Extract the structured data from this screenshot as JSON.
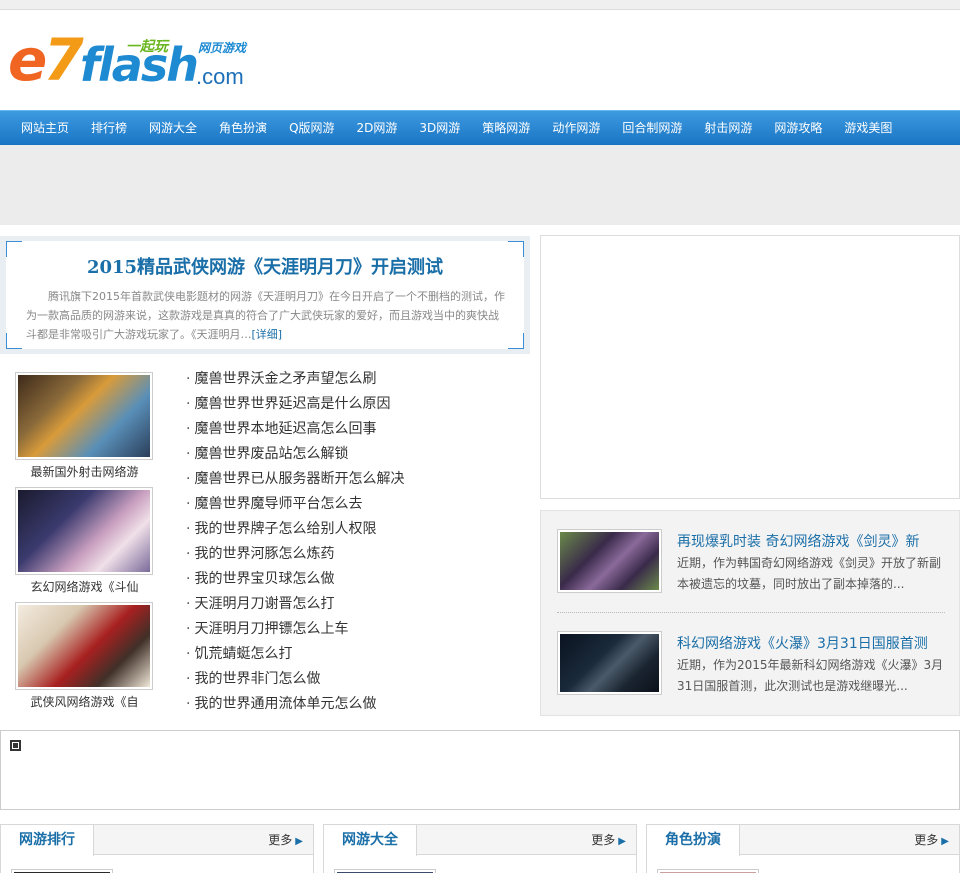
{
  "logo": {
    "brand_e7": "e7",
    "brand_flash": "flash",
    "brand_domain": ".com",
    "tagline_play": "一起玩",
    "tagline_webgame": "网页游戏"
  },
  "nav": {
    "items": [
      "网站主页",
      "排行榜",
      "网游大全",
      "角色扮演",
      "Q版网游",
      "2D网游",
      "3D网游",
      "策略网游",
      "动作网游",
      "回合制网游",
      "射击网游",
      "网游攻略",
      "游戏美图"
    ]
  },
  "headline": {
    "title": "2015精品武侠网游《天涯明月刀》开启测试",
    "summary": "腾讯旗下2015年首款武侠电影题材的网游《天涯明月刀》在今日开启了一个不删档的测试，作为一款高品质的网游来说，这款游戏是真真的符合了广大武侠玩家的爱好，而且游戏当中的爽快战斗都是非常吸引广大游戏玩家了。《天涯明月…",
    "more_label": "[详细]"
  },
  "thumbs": [
    {
      "caption": "最新国外射击网络游",
      "icon": "game-screenshot-shooter"
    },
    {
      "caption": "玄幻网络游戏《斗仙",
      "icon": "game-screenshot-fantasy"
    },
    {
      "caption": "武侠风网络游戏《自",
      "icon": "game-screenshot-wuxia"
    }
  ],
  "links": [
    "魔兽世界沃金之矛声望怎么刷",
    "魔兽世界世界延迟高是什么原因",
    "魔兽世界本地延迟高怎么回事",
    "魔兽世界废品站怎么解锁",
    "魔兽世界已从服务器断开怎么解决",
    "魔兽世界魔导师平台怎么去",
    "我的世界牌子怎么给别人权限",
    "我的世界河豚怎么炼药",
    "我的世界宝贝球怎么做",
    "天涯明月刀谢晋怎么打",
    "天涯明月刀押镖怎么上车",
    "饥荒蜻蜓怎么打",
    "我的世界非门怎么做",
    "我的世界通用流体单元怎么做"
  ],
  "news": [
    {
      "title": "再现爆乳时装 奇幻网络游戏《剑灵》新",
      "desc": "近期，作为韩国奇幻网络游戏《剑灵》开放了新副本被遗忘的坟墓，同时放出了副本掉落的..."
    },
    {
      "title": "科幻网络游戏《火瀑》3月31日国服首测",
      "desc": "近期，作为2015年最新科幻网络游戏《火瀑》3月31日国服首测，此次测试也是游戏继曝光..."
    }
  ],
  "panels": [
    {
      "title": "网游排行",
      "more": "更多"
    },
    {
      "title": "网游大全",
      "more": "更多"
    },
    {
      "title": "角色扮演",
      "more": "更多"
    }
  ],
  "colors": {
    "nav_top": "#3d9be0",
    "nav_bottom": "#1a74c4",
    "link_blue": "#1b6fa8",
    "logo_orange": "#f06522",
    "logo_blue": "#1d8ad2",
    "logo_green": "#6ab61f"
  }
}
